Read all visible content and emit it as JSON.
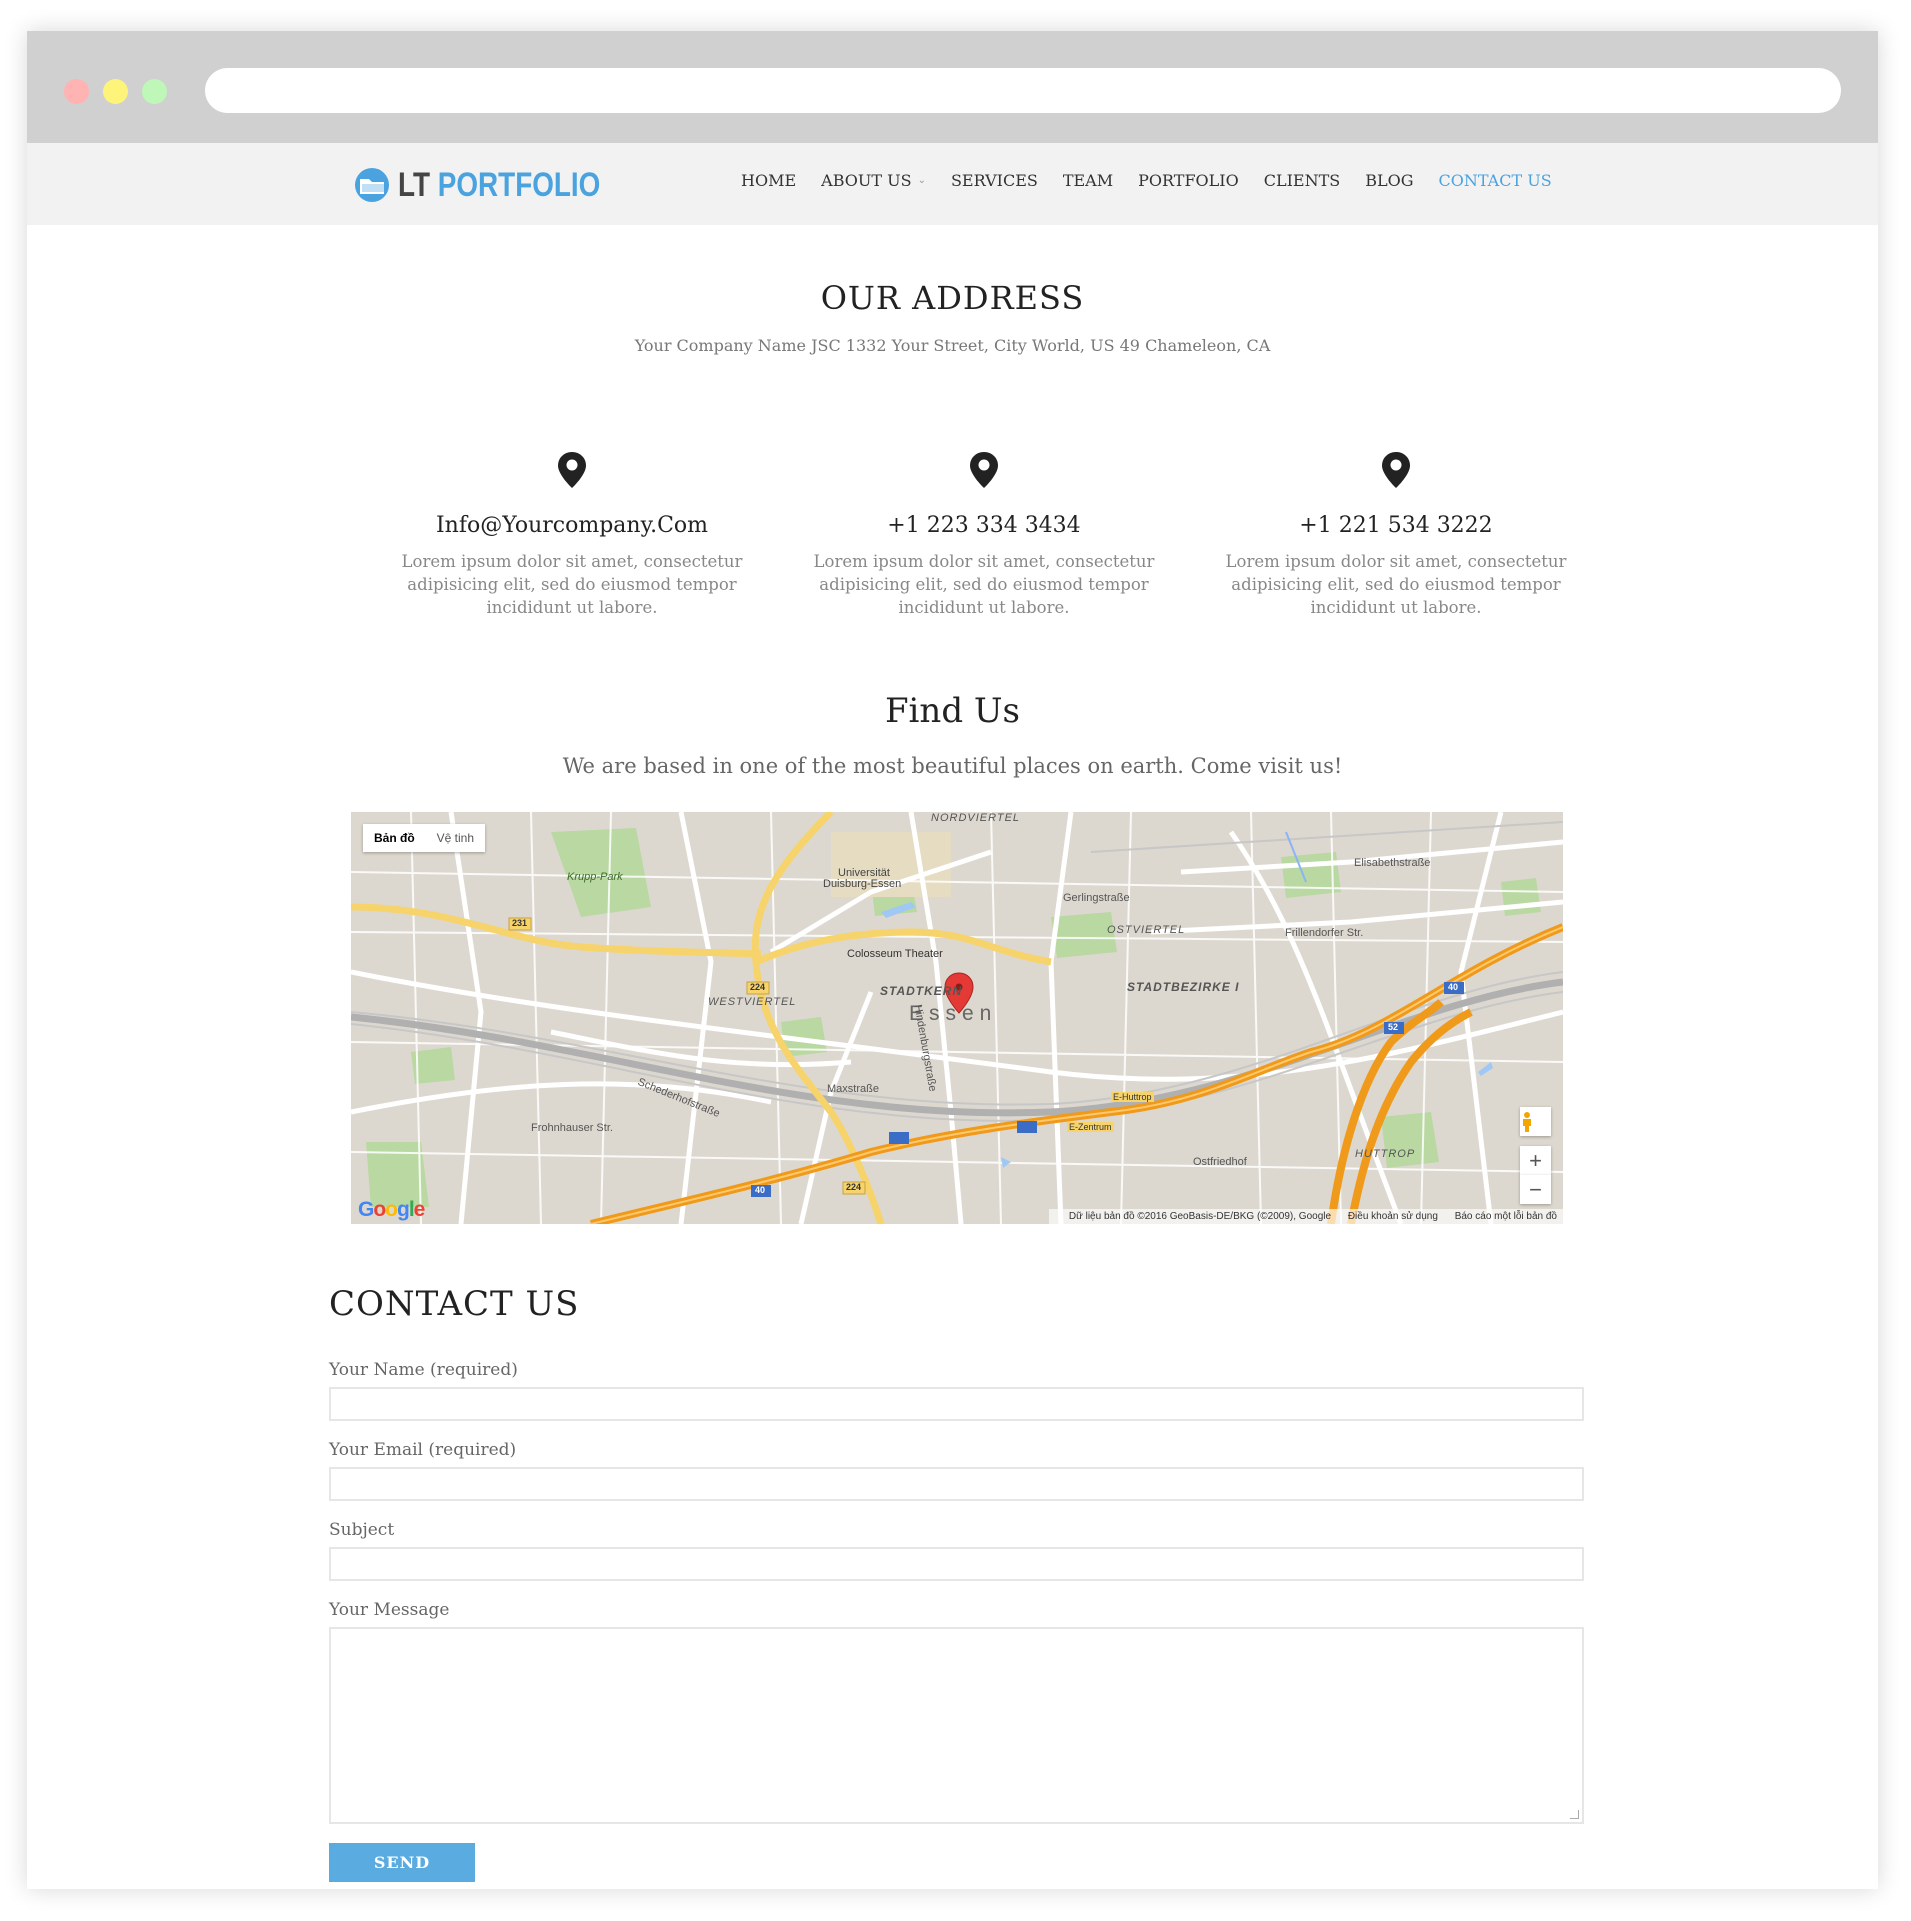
{
  "brand": {
    "logo_lt": "LT",
    "logo_portfolio": "PORTFOLIO",
    "accent": "#4aa3df"
  },
  "nav": {
    "items": [
      {
        "label": "HOME",
        "active": false
      },
      {
        "label": "ABOUT US",
        "active": false,
        "has_dropdown": true
      },
      {
        "label": "SERVICES",
        "active": false
      },
      {
        "label": "TEAM",
        "active": false
      },
      {
        "label": "PORTFOLIO",
        "active": false
      },
      {
        "label": "CLIENTS",
        "active": false
      },
      {
        "label": "BLOG",
        "active": false
      },
      {
        "label": "CONTACT US",
        "active": true
      }
    ]
  },
  "address": {
    "title": "OUR ADDRESS",
    "text": "Your Company Name JSC  1332 Your Street, City World, US  49 Chameleon, CA"
  },
  "info": [
    {
      "icon": "map-pin-icon",
      "title": "Info@Yourcompany.Com",
      "text": "Lorem ipsum dolor sit amet, consectetur adipisicing elit, sed do eiusmod tempor incididunt ut labore."
    },
    {
      "icon": "map-pin-icon",
      "title": "+1 223 334 3434",
      "text": "Lorem ipsum dolor sit amet, consectetur adipisicing elit, sed do eiusmod tempor incididunt ut labore."
    },
    {
      "icon": "map-pin-icon",
      "title": "+1 221 534 3222",
      "text": "Lorem ipsum dolor sit amet, consectetur adipisicing elit, sed do eiusmod tempor incididunt ut labore."
    }
  ],
  "find": {
    "title": "Find Us",
    "subtitle": "We are based in one of the most beautiful places on earth. Come visit us!"
  },
  "map": {
    "type_map": "Bản đồ",
    "type_satellite": "Vệ tinh",
    "city": "Essen",
    "google": "Google",
    "attribution": "Dữ liệu bản đồ ©2016 GeoBasis-DE/BKG (©2009), Google",
    "terms": "Điều khoản sử dụng",
    "report": "Báo cáo một lỗi bản đồ",
    "zoom_in": "+",
    "zoom_out": "−",
    "labels": {
      "nordviertel": "NORDVIERTEL",
      "universitat": "Universität",
      "duisburg": "Duisburg-Essen",
      "krupp": "Krupp-Park",
      "colosseum": "Colosseum Theater",
      "westviertel": "WESTVIERTEL",
      "stadtkern": "STADTKERN",
      "ostviertel": "OSTVIERTEL",
      "stadtbezirke": "STADTBEZIRKE I",
      "gerlingstrasse": "Gerlingstraße",
      "frillendorfer": "Frillendorfer Str.",
      "elisabeth": "Elisabethstraße",
      "huttrop": "HUTTROP",
      "ostfriedhof": "Ostfriedhof",
      "maxstrasse": "Maxstraße",
      "frohnhauser": "Frohnhauser Str.",
      "schederhof": "Schederhofstraße",
      "hindenburg": "Hindenburgstraße",
      "e_huttrop": "E-Huttrop",
      "e_zentrum": "E-Zentrum",
      "r231": "231",
      "r224": "224",
      "a40": "40",
      "a52": "52",
      "r224b": "224",
      "a40b": "40"
    }
  },
  "contact": {
    "title": "CONTACT US",
    "name_label": "Your Name (required)",
    "name_value": "",
    "email_label": "Your Email (required)",
    "email_value": "",
    "subject_label": "Subject",
    "subject_value": "",
    "message_label": "Your Message",
    "message_value": "",
    "send_label": "SEND"
  }
}
